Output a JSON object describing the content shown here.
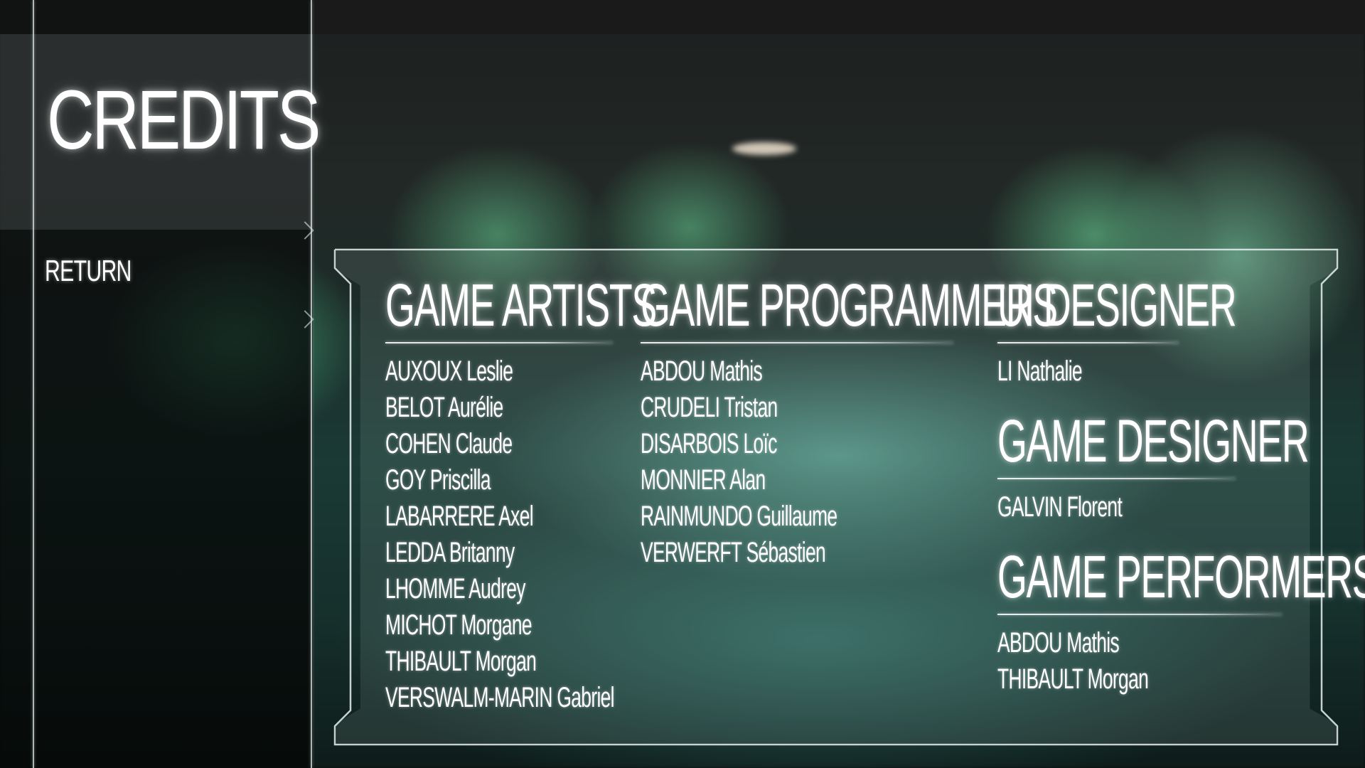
{
  "screen": {
    "title": "CREDITS",
    "return_label": "RETURN"
  },
  "sections": {
    "artists": {
      "heading": "GAME ARTISTS",
      "names": [
        "AUXOUX Leslie",
        "BELOT Aurélie",
        "COHEN Claude",
        "GOY Priscilla",
        "LABARRERE Axel",
        "LEDDA Britanny",
        "LHOMME Audrey",
        "MICHOT Morgane",
        "THIBAULT Morgan",
        "VERSWALM-MARIN Gabriel"
      ]
    },
    "programmers": {
      "heading": "GAME PROGRAMMERS",
      "names": [
        "ABDOU Mathis",
        "CRUDELI Tristan",
        "DISARBOIS Loïc",
        "MONNIER Alan",
        "RAINMUNDO Guillaume",
        "VERWERFT Sébastien"
      ]
    },
    "ui_designer": {
      "heading": "UI DESIGNER",
      "names": [
        "LI Nathalie"
      ]
    },
    "game_designer": {
      "heading": "GAME DESIGNER",
      "names": [
        "GALVIN Florent"
      ]
    },
    "performers": {
      "heading": "GAME PERFORMERS",
      "names": [
        "ABDOU Mathis",
        "THIBAULT Morgan"
      ]
    }
  },
  "colors": {
    "text": "#ffffff",
    "frame": "#e6f0f0",
    "ambient_glow": "#78d2be"
  }
}
